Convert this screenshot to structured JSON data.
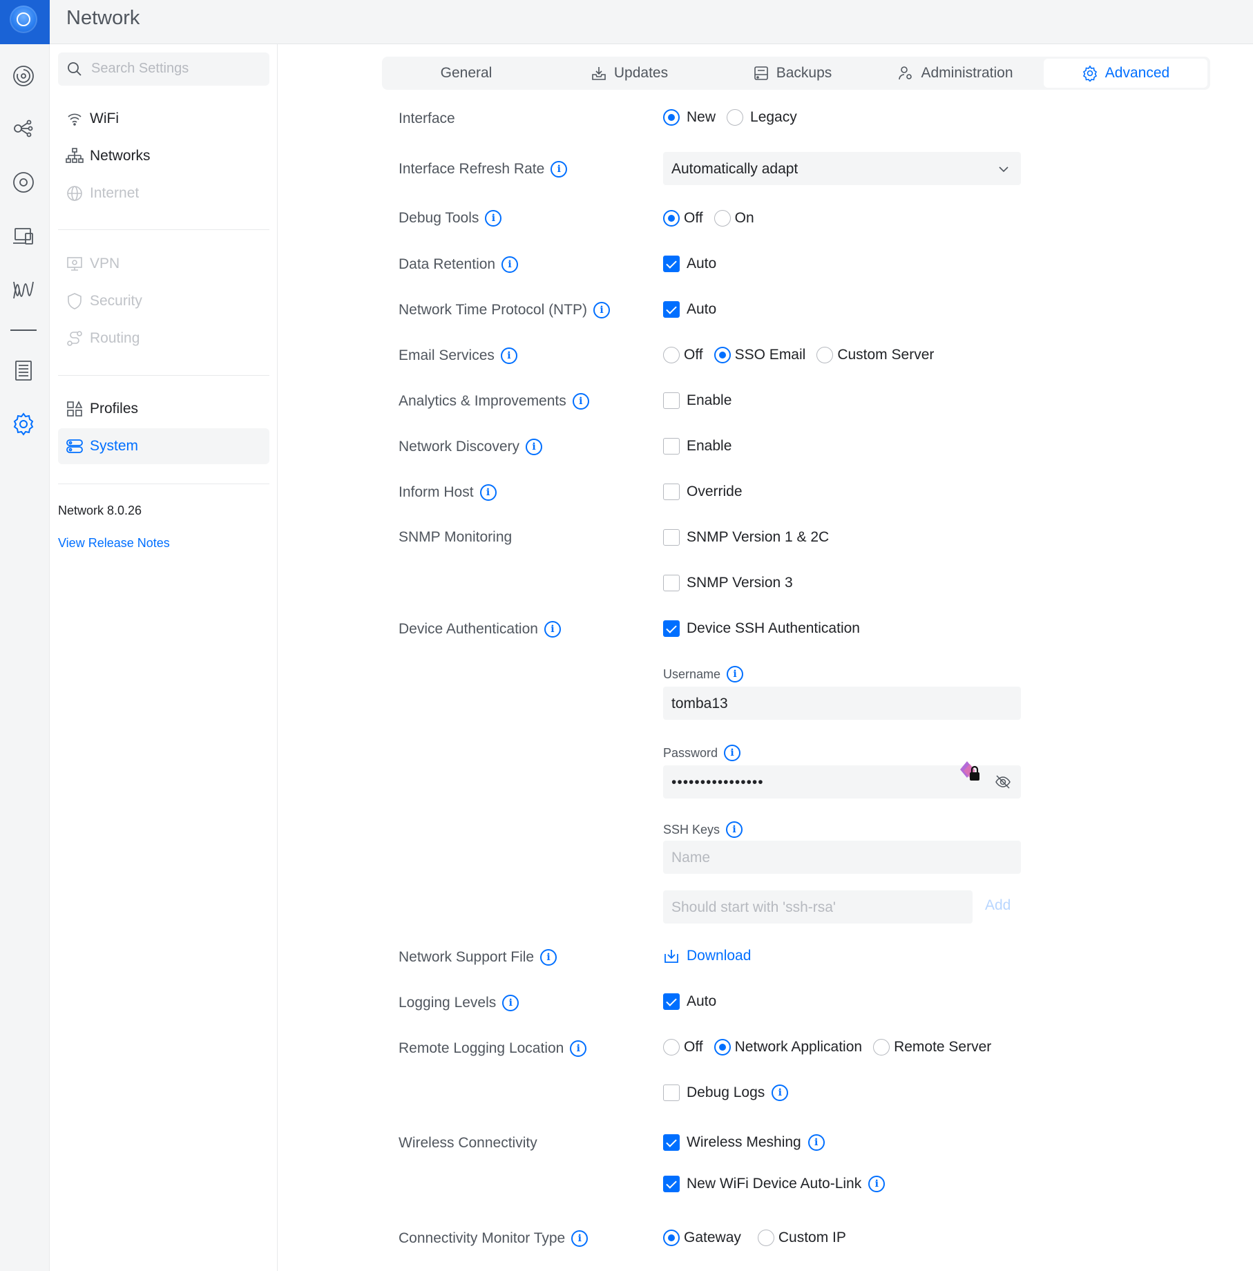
{
  "app": {
    "title": "Network"
  },
  "sidebar": {
    "search_placeholder": "Search Settings",
    "items": [
      {
        "label": "WiFi",
        "icon": "wifi-icon",
        "enabled": true
      },
      {
        "label": "Networks",
        "icon": "networks-icon",
        "enabled": true
      },
      {
        "label": "Internet",
        "icon": "globe-icon",
        "enabled": false
      },
      {
        "label": "VPN",
        "icon": "vpn-icon",
        "enabled": false
      },
      {
        "label": "Security",
        "icon": "shield-icon",
        "enabled": false
      },
      {
        "label": "Routing",
        "icon": "routing-icon",
        "enabled": false
      },
      {
        "label": "Profiles",
        "icon": "profiles-icon",
        "enabled": true
      },
      {
        "label": "System",
        "icon": "system-icon",
        "enabled": true,
        "active": true
      }
    ],
    "version": "Network 8.0.26",
    "release_notes": "View Release Notes"
  },
  "tabs": [
    {
      "label": "General",
      "active": false
    },
    {
      "label": "Updates",
      "icon": "updates-icon",
      "active": false
    },
    {
      "label": "Backups",
      "icon": "backups-icon",
      "active": false
    },
    {
      "label": "Administration",
      "icon": "admin-icon",
      "active": false
    },
    {
      "label": "Advanced",
      "icon": "gear-icon",
      "active": true
    }
  ],
  "form": {
    "interface": {
      "label": "Interface",
      "options": [
        "New",
        "Legacy"
      ],
      "selected": "New"
    },
    "refresh_rate": {
      "label": "Interface Refresh Rate",
      "value": "Automatically adapt"
    },
    "debug_tools": {
      "label": "Debug Tools",
      "options": [
        "Off",
        "On"
      ],
      "selected": "Off"
    },
    "data_retention": {
      "label": "Data Retention",
      "checkbox": "Auto",
      "checked": true
    },
    "ntp": {
      "label": "Network Time Protocol (NTP)",
      "checkbox": "Auto",
      "checked": true
    },
    "email_services": {
      "label": "Email Services",
      "options": [
        "Off",
        "SSO Email",
        "Custom Server"
      ],
      "selected": "SSO Email"
    },
    "analytics": {
      "label": "Analytics & Improvements",
      "checkbox": "Enable",
      "checked": false
    },
    "network_discovery": {
      "label": "Network Discovery",
      "checkbox": "Enable",
      "checked": false
    },
    "inform_host": {
      "label": "Inform Host",
      "checkbox": "Override",
      "checked": false
    },
    "snmp": {
      "label": "SNMP Monitoring",
      "v1": "SNMP Version 1 & 2C",
      "v1_checked": false,
      "v3": "SNMP Version 3",
      "v3_checked": false
    },
    "device_auth": {
      "label": "Device Authentication",
      "checkbox": "Device SSH Authentication",
      "checked": true,
      "username_label": "Username",
      "username": "tomba13",
      "password_label": "Password",
      "password": "••••••••••••••••",
      "ssh_keys_label": "SSH Keys",
      "ssh_name_placeholder": "Name",
      "ssh_key_placeholder": "Should start with 'ssh-rsa'",
      "add_label": "Add"
    },
    "support_file": {
      "label": "Network Support File",
      "action": "Download"
    },
    "logging_levels": {
      "label": "Logging Levels",
      "checkbox": "Auto",
      "checked": true
    },
    "remote_logging": {
      "label": "Remote Logging Location",
      "options": [
        "Off",
        "Network Application",
        "Remote Server"
      ],
      "selected": "Network Application",
      "debug_logs": "Debug Logs",
      "debug_logs_checked": false
    },
    "wireless": {
      "label": "Wireless Connectivity",
      "meshing": "Wireless Meshing",
      "meshing_checked": true,
      "autolink": "New WiFi Device Auto-Link",
      "autolink_checked": true
    },
    "monitor_type": {
      "label": "Connectivity Monitor Type",
      "options": [
        "Gateway",
        "Custom IP"
      ],
      "selected": "Gateway"
    }
  },
  "colors": {
    "accent": "#006fff",
    "brand": "#1a63d6",
    "muted_text": "#50565e",
    "disabled_text": "#c0c3c8",
    "panel_bg": "#f4f5f6"
  }
}
